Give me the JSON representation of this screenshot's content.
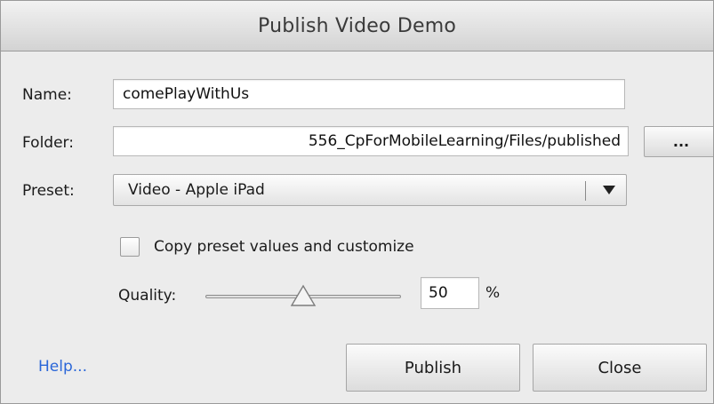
{
  "dialog": {
    "title": "Publish Video Demo"
  },
  "form": {
    "name": {
      "label": "Name:",
      "value": "comePlayWithUs"
    },
    "folder": {
      "label": "Folder:",
      "value": "556_CpForMobileLearning/Files/published",
      "browse_label": "..."
    },
    "preset": {
      "label": "Preset:",
      "selected": "Video - Apple iPad"
    },
    "customize": {
      "label": "Copy preset values and customize",
      "checked": false
    },
    "quality": {
      "label": "Quality:",
      "value": "50",
      "unit": "%",
      "level": 0.5
    }
  },
  "footer": {
    "help_label": "Help...",
    "publish_label": "Publish",
    "close_label": "Close"
  },
  "colors": {
    "link": "#2a66d8",
    "title_text": "#3a3a3a",
    "dialog_bg": "#ececec"
  }
}
